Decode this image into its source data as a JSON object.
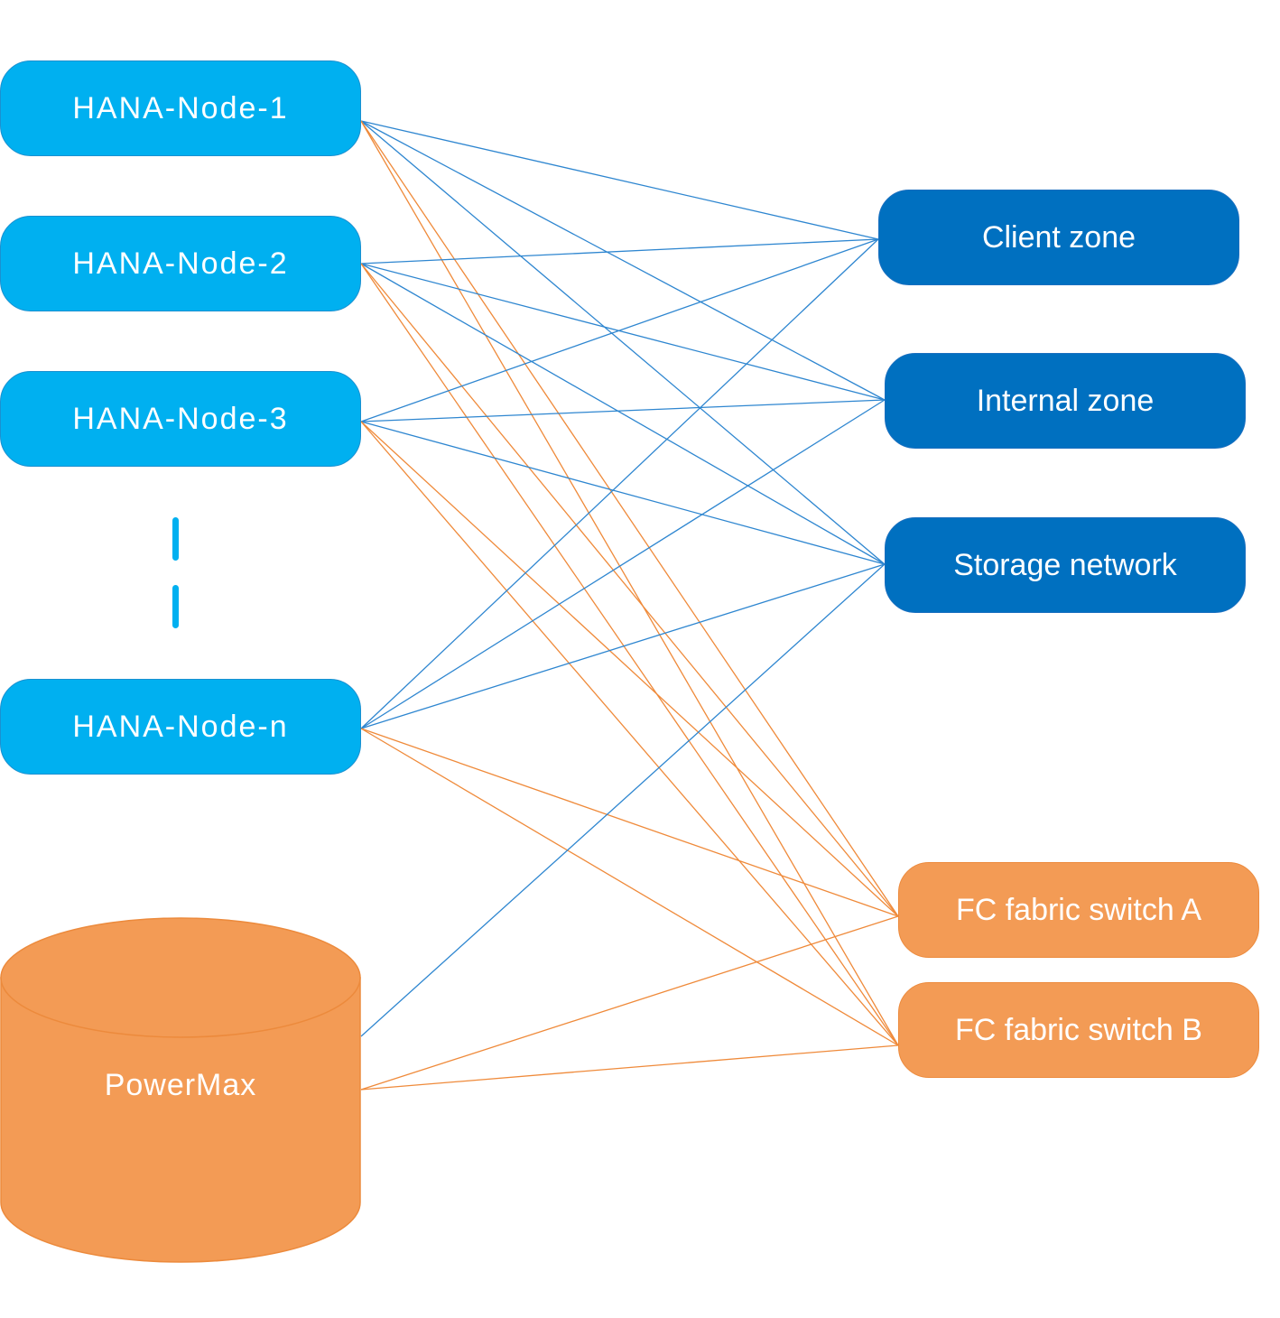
{
  "colors": {
    "hana_fill": "#00b0f0",
    "zone_fill": "#0070c0",
    "fc_fill": "#f39b55",
    "blue_link": "#2e86d0",
    "orange_link": "#ef8a3a"
  },
  "hana_nodes": [
    {
      "id": "n1",
      "label": "HANA-Node-1"
    },
    {
      "id": "n2",
      "label": "HANA-Node-2"
    },
    {
      "id": "n3",
      "label": "HANA-Node-3"
    },
    {
      "id": "nn",
      "label": "HANA-Node-n"
    }
  ],
  "ellipsis_icon": "vertical-dashed-line",
  "zones": [
    {
      "id": "client",
      "label": "Client zone"
    },
    {
      "id": "internal",
      "label": "Internal zone"
    },
    {
      "id": "storage",
      "label": "Storage network"
    }
  ],
  "fc_switches": [
    {
      "id": "fcA",
      "label": "FC fabric switch A"
    },
    {
      "id": "fcB",
      "label": "FC fabric switch B"
    }
  ],
  "storage": {
    "id": "powermax",
    "label": "PowerMax",
    "icon": "cylinder-database"
  },
  "links": [
    {
      "from": "n1",
      "to": "client",
      "type": "network"
    },
    {
      "from": "n1",
      "to": "internal",
      "type": "network"
    },
    {
      "from": "n1",
      "to": "storage",
      "type": "network"
    },
    {
      "from": "n1",
      "to": "fcA",
      "type": "fc"
    },
    {
      "from": "n1",
      "to": "fcB",
      "type": "fc"
    },
    {
      "from": "n2",
      "to": "client",
      "type": "network"
    },
    {
      "from": "n2",
      "to": "internal",
      "type": "network"
    },
    {
      "from": "n2",
      "to": "storage",
      "type": "network"
    },
    {
      "from": "n2",
      "to": "fcA",
      "type": "fc"
    },
    {
      "from": "n2",
      "to": "fcB",
      "type": "fc"
    },
    {
      "from": "n3",
      "to": "client",
      "type": "network"
    },
    {
      "from": "n3",
      "to": "internal",
      "type": "network"
    },
    {
      "from": "n3",
      "to": "storage",
      "type": "network"
    },
    {
      "from": "n3",
      "to": "fcA",
      "type": "fc"
    },
    {
      "from": "n3",
      "to": "fcB",
      "type": "fc"
    },
    {
      "from": "nn",
      "to": "client",
      "type": "network"
    },
    {
      "from": "nn",
      "to": "internal",
      "type": "network"
    },
    {
      "from": "nn",
      "to": "storage",
      "type": "network"
    },
    {
      "from": "nn",
      "to": "fcA",
      "type": "fc"
    },
    {
      "from": "nn",
      "to": "fcB",
      "type": "fc"
    },
    {
      "from": "powermax",
      "to": "storage",
      "type": "network"
    },
    {
      "from": "powermax",
      "to": "fcA",
      "type": "fc"
    },
    {
      "from": "powermax",
      "to": "fcB",
      "type": "fc"
    }
  ]
}
